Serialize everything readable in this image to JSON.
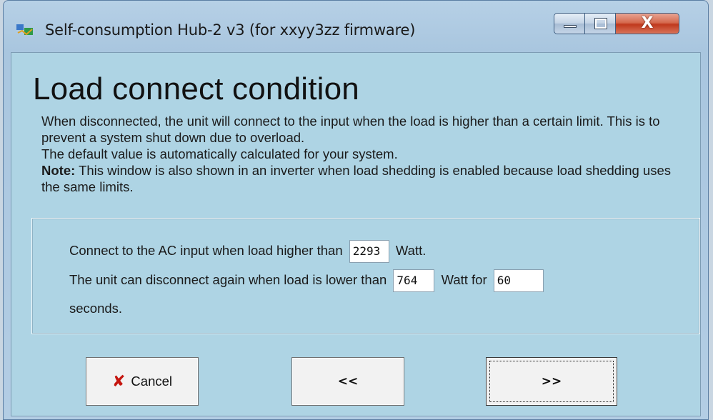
{
  "window": {
    "title": "Self-consumption Hub-2 v3 (for xxyy3zz firmware)",
    "close_glyph": "X",
    "colors": {
      "client_bg": "#aed4e4",
      "close_button": "#c0391d"
    }
  },
  "page": {
    "heading": "Load connect condition",
    "desc_line1": "When disconnected, the unit will connect to the input when the load is higher than a certain limit. This is to prevent a system shut down due to overload.",
    "desc_line2": "The default value is automatically calculated for your system.",
    "note_label": "Note:",
    "note_text": " This window is also shown in an inverter when load shedding is enabled because load shedding uses the same limits."
  },
  "settings": {
    "connect_prefix": "Connect to the AC input when load higher than",
    "connect_value": "2293",
    "connect_suffix": "Watt.",
    "disconnect_prefix": "The unit can disconnect again when load is lower than",
    "disconnect_value": "764",
    "disconnect_mid": "Watt for",
    "seconds_value": "60",
    "seconds_label": "seconds."
  },
  "buttons": {
    "cancel_label": "Cancel",
    "cancel_icon": "x-icon",
    "back_label": "<<",
    "next_label": ">>"
  }
}
